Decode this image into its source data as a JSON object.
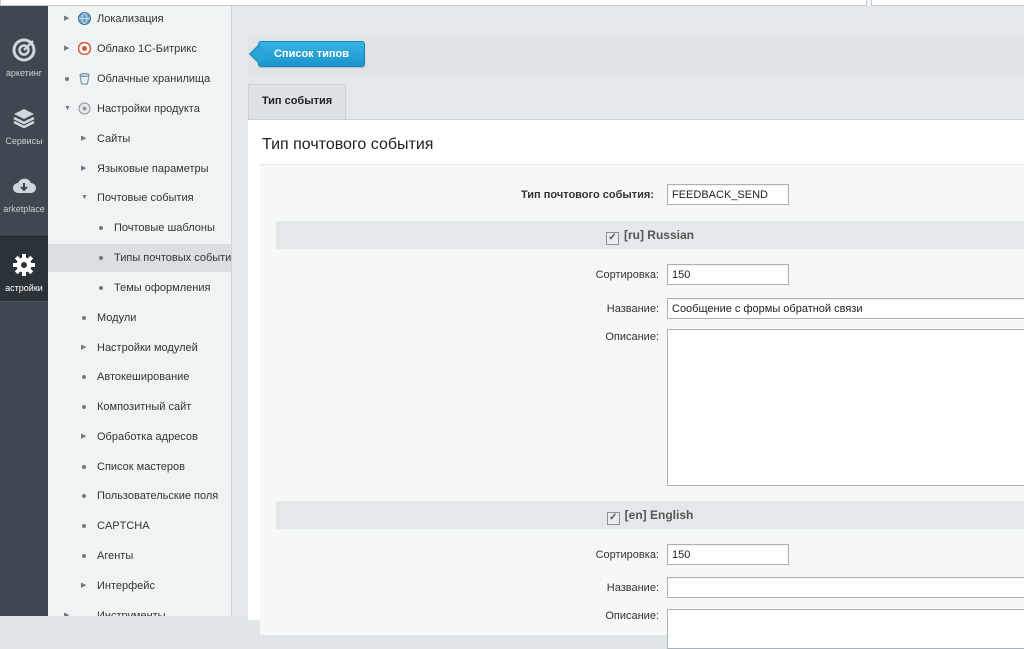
{
  "rail": [
    {
      "label": "аркетинг",
      "icon": "target-icon"
    },
    {
      "label": "Сервисы",
      "icon": "layers-icon"
    },
    {
      "label": "arketplace",
      "icon": "cloud-download-icon"
    },
    {
      "label": "астройки",
      "icon": "gear-icon",
      "active": true
    }
  ],
  "tree": [
    {
      "label": "Локализация",
      "icon": "globe-icon",
      "marker": "arrow-right"
    },
    {
      "label": "Облако 1С-Битрикс",
      "icon": "cloud-icon",
      "marker": "arrow-right"
    },
    {
      "label": "Облачные хранилища",
      "icon": "bucket-icon",
      "marker": "dot"
    },
    {
      "label": "Настройки продукта",
      "icon": "settings-icon",
      "marker": "arrow-down"
    },
    {
      "label": "Сайты",
      "marker": "arrow-right"
    },
    {
      "label": "Языковые параметры",
      "marker": "arrow-right"
    },
    {
      "label": "Почтовые события",
      "marker": "arrow-down"
    },
    {
      "label": "Почтовые шаблоны",
      "marker": "dot"
    },
    {
      "label": "Типы почтовых событий",
      "marker": "dot",
      "selected": true
    },
    {
      "label": "Темы оформления",
      "marker": "dot"
    },
    {
      "label": "Модули",
      "marker": "dot"
    },
    {
      "label": "Настройки модулей",
      "marker": "arrow-right"
    },
    {
      "label": "Автокеширование",
      "marker": "dot"
    },
    {
      "label": "Композитный сайт",
      "marker": "dot"
    },
    {
      "label": "Обработка адресов",
      "marker": "arrow-right"
    },
    {
      "label": "Список мастеров",
      "marker": "dot"
    },
    {
      "label": "Пользовательские поля",
      "marker": "dot"
    },
    {
      "label": "CAPTCHA",
      "marker": "dot"
    },
    {
      "label": "Агенты",
      "marker": "dot"
    },
    {
      "label": "Интерфейс",
      "marker": "arrow-right"
    },
    {
      "label": "Инструменты",
      "marker": "arrow-right"
    }
  ],
  "toolbar": {
    "list_button": "Список типов"
  },
  "tab": {
    "label": "Тип события"
  },
  "page_title": "Тип почтового события",
  "form": {
    "event_type_label": "Тип почтового события:",
    "event_type_value": "FEEDBACK_SEND",
    "ru": {
      "header": "[ru] Russian",
      "sort_label": "Сортировка:",
      "sort_value": "150",
      "name_label": "Название:",
      "name_value": "Сообщение с формы обратной связи",
      "desc_label": "Описание:"
    },
    "en": {
      "header": "[en] English",
      "sort_label": "Сортировка:",
      "sort_value": "150",
      "name_label": "Название:",
      "name_value": "",
      "desc_label": "Описание:"
    }
  }
}
